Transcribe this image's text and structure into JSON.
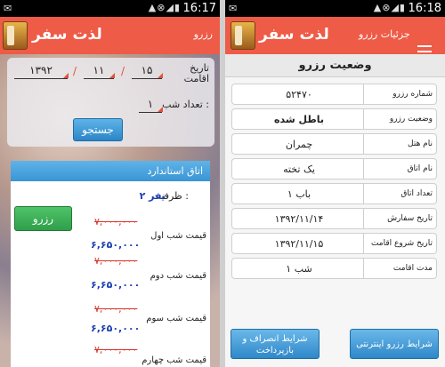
{
  "status_bar": {
    "left_time": "16:17",
    "right_time": "16:18"
  },
  "app": {
    "title": "لذت سفر"
  },
  "left_screen": {
    "subtitle": "رزرو",
    "search": {
      "date_label": "تاریخ اقامت",
      "year": "۱۳۹۲",
      "month": "۱۱",
      "day": "۱۵",
      "separator": "/",
      "nights_label": "تعداد شب :",
      "nights_value": "۱",
      "search_button": "جستجو"
    },
    "result": {
      "room_name": "اتاق استاندارد",
      "capacity_label": "ظرفیت :",
      "capacity_value": "۲ نفر",
      "reserve_button": "رزرو",
      "nights": [
        {
          "label": "قیمت شب اول",
          "old_price": "۷,۰۰۰,۰۰۰",
          "new_price": "۶,۶۵۰,۰۰۰"
        },
        {
          "label": "قیمت شب دوم",
          "old_price": "۷,۰۰۰,۰۰۰",
          "new_price": "۶,۶۵۰,۰۰۰"
        },
        {
          "label": "قیمت شب سوم",
          "old_price": "۷,۰۰۰,۰۰۰",
          "new_price": "۶,۶۵۰,۰۰۰"
        },
        {
          "label": "قیمت شب چهارم",
          "old_price": "۷,۰۰۰,۰۰۰",
          "new_price": ""
        }
      ]
    }
  },
  "right_screen": {
    "subtitle": "جزئیات رزرو",
    "page_title": "وضعیت رزرو",
    "details": [
      {
        "label": "شماره رزرو",
        "value": "۵۲۴۷۰"
      },
      {
        "label": "وضعیت رزرو",
        "value": "باطل شده"
      },
      {
        "label": "نام هتل",
        "value": "چمران"
      },
      {
        "label": "نام اتاق",
        "value": "یک تخته"
      },
      {
        "label": "تعداد اتاق",
        "value": "۱ باب"
      },
      {
        "label": "تاریخ سفارش",
        "value": "۱۳۹۲/۱۱/۱۴"
      },
      {
        "label": "تاریخ شروع اقامت",
        "value": "۱۳۹۲/۱۱/۱۵"
      },
      {
        "label": "مدت اقامت",
        "value": "۱ شب"
      }
    ],
    "buttons": {
      "cancel_terms": "شرایط انصراف و بازپرداخت",
      "online_terms": "شرایط رزرو اینترنتی"
    }
  },
  "colors": {
    "appbar": "#ee5b47",
    "accent_blue": "#3a95d4",
    "reserve_green": "#2f9f49",
    "old_price_red": "#d9342b",
    "new_price_blue": "#1a3fb0"
  }
}
